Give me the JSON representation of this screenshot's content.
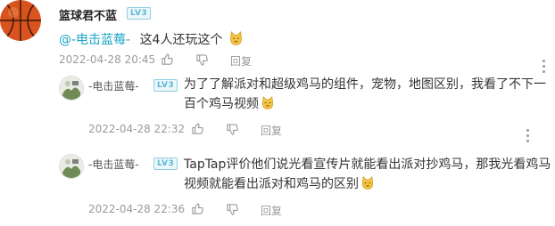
{
  "main_comment": {
    "username": "篮球君不蓝",
    "level": "LV3",
    "mention": "@-电击蓝莓-",
    "text": "这4人还玩这个",
    "emoji_icon": "cat-smile-emoji-icon",
    "timestamp": "2022-04-28 20:45",
    "reply_label": "回复"
  },
  "replies": [
    {
      "username": "-电击蓝莓-",
      "level": "LV3",
      "text": "为了了解派对和超级鸡马的组件，宠物，地图区别，我看了不下一百个鸡马视频",
      "emoji_icon": "cat-smile-emoji-icon",
      "timestamp": "2022-04-28 22:32",
      "reply_label": "回复"
    },
    {
      "username": "-电击蓝莓-",
      "level": "LV3",
      "text": "TapTap评价他们说光看宣传片就能看出派对抄鸡马，那我光看鸡马视频就能看出派对和鸡马的区别",
      "emoji_icon": "cat-smile-emoji-icon",
      "timestamp": "2022-04-28 22:36",
      "reply_label": "回复"
    }
  ],
  "colors": {
    "mention": "#18a3c7",
    "badge": "#5db7d4",
    "meta": "#9a9a9a"
  }
}
